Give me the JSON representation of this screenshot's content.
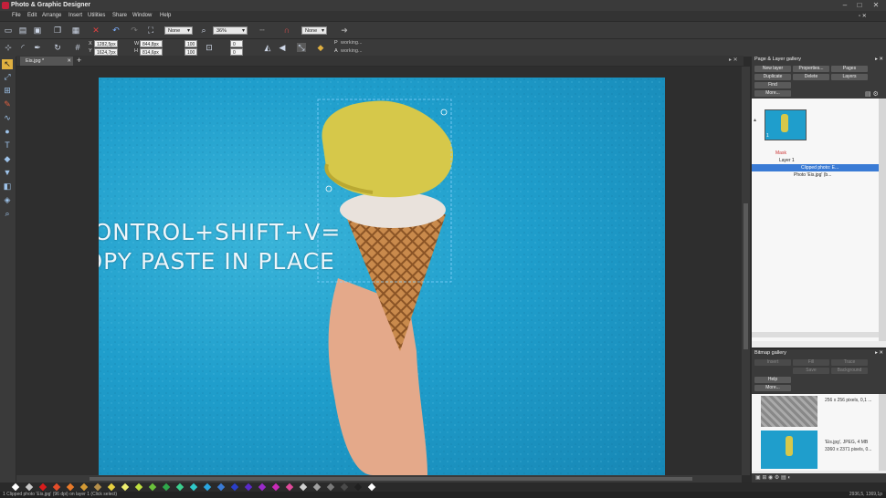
{
  "app": {
    "title": "Photo & Graphic Designer"
  },
  "menu": [
    "File",
    "Edit",
    "Arrange",
    "Insert",
    "Utilities",
    "Share",
    "Window",
    "Help"
  ],
  "toolbar1": {
    "fill_select": "None",
    "zoom_select": "36%",
    "line_select": "None"
  },
  "toolbar2": {
    "x_value": "1282,5px",
    "y_value": "1624,7px",
    "w_label": "W",
    "w_value": "844,8px",
    "h_label": "H",
    "h_value": "814,6px",
    "sx_value": "100",
    "sy_value": "100",
    "r_value": "0",
    "sk_value": "0",
    "status_p": "working...",
    "status_a": "working..."
  },
  "document": {
    "tab_label": "Eis.jpg *"
  },
  "canvas": {
    "caption_line1": "CONTROL+SHIFT+V=",
    "caption_line2": "COPY PASTE IN PLACE"
  },
  "page_layer_gallery": {
    "title": "Page & Layer gallery",
    "buttons": [
      "New layer",
      "Properties...",
      "Pages",
      "Duplicate",
      "Delete",
      "Layers",
      "Find",
      "More..."
    ],
    "tree": [
      "Mask",
      "Layer 1",
      "Clipped photo: E...",
      "Photo 'Eis.jpg' (b..."
    ],
    "page_number": "1"
  },
  "bitmap_gallery": {
    "title": "Bitmap gallery",
    "buttons": [
      "Insert",
      "Fill",
      "Trace",
      "Save",
      "Background",
      "Help",
      "More..."
    ],
    "items": [
      {
        "line1": "256 x 256 pixels, 0,1 ..."
      },
      {
        "line1": "'Eis.jpg', JPEG, 4 MB",
        "line2": "3360 x 2371 pixels, 0..."
      }
    ]
  },
  "status": {
    "text": "1 Clipped photo 'Eis.jpg' (96 dpi) on layer 1 (Click select)",
    "coords": "2936,5, 1369,1p"
  },
  "colors": {
    "accent": "#3a7bd5",
    "swatches": [
      "#ffffff",
      "#c8c8c8",
      "#d91c1c",
      "#e44d2a",
      "#e87a2a",
      "#d49a34",
      "#b58f4a",
      "#e8d040",
      "#f0f070",
      "#c0e040",
      "#6ac23c",
      "#2fa84b",
      "#3ccf8f",
      "#2fc9c9",
      "#2aa6e0",
      "#3a7bd5",
      "#2a3fc9",
      "#5a2ac9",
      "#9a2ac9",
      "#c92ab8",
      "#e04a9a",
      "#d0d0d0",
      "#a0a0a0",
      "#7a7a7a",
      "#4a4a4a",
      "#202020",
      "#ffffff"
    ]
  }
}
